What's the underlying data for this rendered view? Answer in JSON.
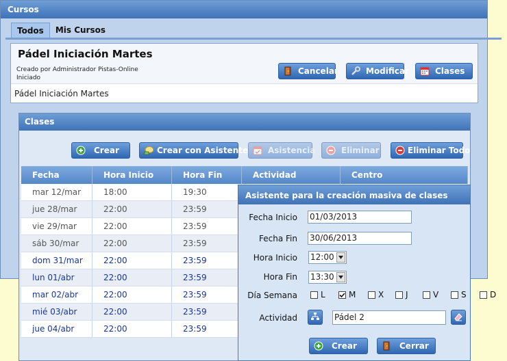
{
  "window": {
    "title": "Cursos"
  },
  "tabs": [
    {
      "label": "Todos"
    },
    {
      "label": "Mis Cursos"
    }
  ],
  "course": {
    "title": "Pádel Iniciación Martes",
    "created_by": "Creado por Administrador Pistas-Online",
    "status": "Iniciado",
    "description": "Pádel Iniciación Martes",
    "buttons": {
      "cancel": "Cancelar",
      "modify": "Modificar",
      "classes": "Clases"
    }
  },
  "classes_panel": {
    "title": "Clases",
    "buttons": {
      "create": "Crear",
      "create_wizard": "Crear con Asistente",
      "attendance": "Asistencia",
      "delete": "Eliminar",
      "delete_all": "Eliminar Todo"
    },
    "columns": [
      "Fecha",
      "Hora Inicio",
      "Hora Fin",
      "Actividad",
      "Centro"
    ],
    "rows": [
      {
        "fecha": "mar 12/mar",
        "inicio": "18:00",
        "fin": "19:30",
        "past": true
      },
      {
        "fecha": "jue 28/mar",
        "inicio": "22:00",
        "fin": "23:59",
        "past": true
      },
      {
        "fecha": "vie 29/mar",
        "inicio": "22:00",
        "fin": "23:59",
        "past": true
      },
      {
        "fecha": "sáb 30/mar",
        "inicio": "22:00",
        "fin": "23:59",
        "past": true
      },
      {
        "fecha": "dom 31/mar",
        "inicio": "22:00",
        "fin": "23:59",
        "past": false
      },
      {
        "fecha": "lun 01/abr",
        "inicio": "22:00",
        "fin": "23:59",
        "past": false
      },
      {
        "fecha": "mar 02/abr",
        "inicio": "22:00",
        "fin": "23:59",
        "past": false
      },
      {
        "fecha": "mié 03/abr",
        "inicio": "22:00",
        "fin": "23:59",
        "past": false
      },
      {
        "fecha": "jue 04/abr",
        "inicio": "22:00",
        "fin": "23:59",
        "past": false
      }
    ]
  },
  "wizard": {
    "title": "Asistente para la creación masiva de clases",
    "fecha_inicio_label": "Fecha Inicio",
    "fecha_inicio": "01/03/2013",
    "fecha_fin_label": "Fecha Fin",
    "fecha_fin": "30/06/2013",
    "hora_inicio_label": "Hora Inicio",
    "hora_inicio": "12:00",
    "hora_fin_label": "Hora Fin",
    "hora_fin": "13:30",
    "dia_semana_label": "Día Semana",
    "days": [
      {
        "label": "L",
        "checked": false
      },
      {
        "label": "M",
        "checked": true
      },
      {
        "label": "X",
        "checked": false
      },
      {
        "label": "J",
        "checked": false
      },
      {
        "label": "V",
        "checked": false
      },
      {
        "label": "S",
        "checked": false
      },
      {
        "label": "D",
        "checked": false
      }
    ],
    "actividad_label": "Actividad",
    "actividad": "Pádel 2",
    "create_button": "Crear",
    "close_button": "Cerrar"
  }
}
